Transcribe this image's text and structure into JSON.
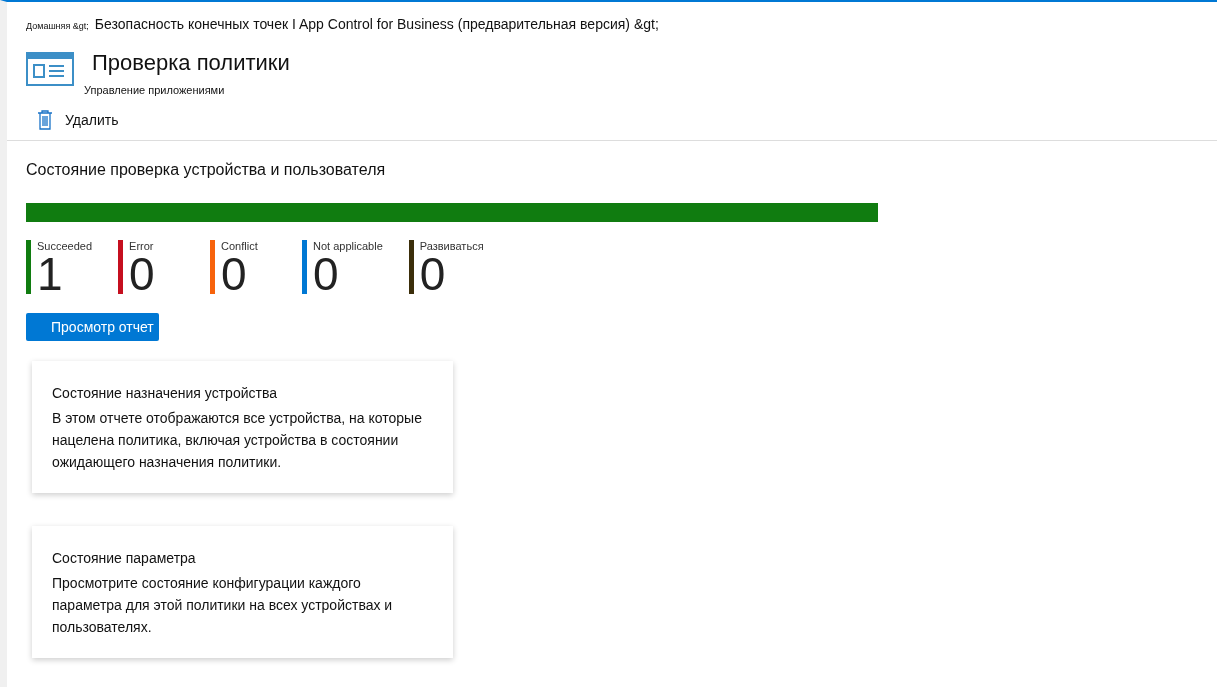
{
  "breadcrumb": {
    "home": "Домашняя &gt;",
    "path": "Безопасность конечных точек I App Control for Business (предварительная версия) &gt;"
  },
  "header": {
    "title": "Проверка политики",
    "subtitle": "Управление приложениями"
  },
  "toolbar": [
    {
      "label": "Удалить"
    }
  ],
  "status": {
    "title": "Состояние проверка устройства и пользователя",
    "level": 1,
    "stats": [
      {
        "label": "Succeeded",
        "value": "1",
        "color": "#107c10"
      },
      {
        "label": "Error",
        "value": "0",
        "color": "#c50f1f"
      },
      {
        "label": "Conflict",
        "value": "0",
        "color": "#f7630c"
      },
      {
        "label": "Not applicable",
        "value": "0",
        "color": "#0078d4"
      },
      {
        "label": "Развиваться",
        "value": "0",
        "color": "#3b2e0a"
      }
    ],
    "button": "Просмотр отчет"
  },
  "cards": [
    {
      "title": "Состояние назначения устройства",
      "text": "В этом отчете отображаются все устройства, на которые нацелена политика, включая устройства в состоянии ожидающего назначения политики."
    },
    {
      "title": "Состояние параметра",
      "text": "Просмотрите состояние конфигурации каждого параметра для этой политики на всех устройствах и пользователях."
    }
  ]
}
